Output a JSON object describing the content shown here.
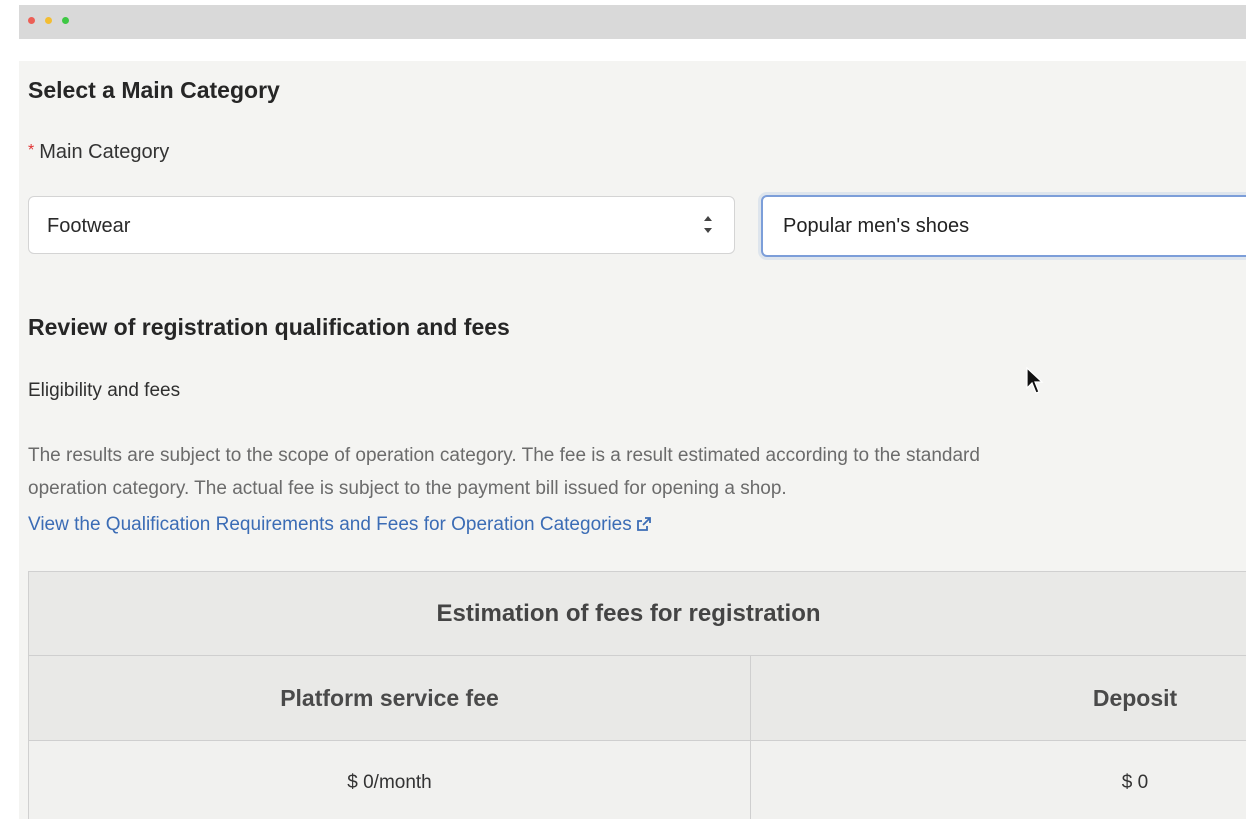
{
  "window": {
    "controls": [
      "close",
      "minimize",
      "maximize"
    ],
    "colors": {
      "close": "#ec5f56",
      "minimize": "#f3bd32",
      "maximize": "#3ec844"
    }
  },
  "form": {
    "section_title": "Select a Main Category",
    "main_category_label": "Main Category",
    "required_mark": "*",
    "main_category_value": "Footwear",
    "subcategory_value": "Popular men's shoes"
  },
  "review": {
    "title": "Review of registration qualification and fees",
    "subtitle": "Eligibility and fees",
    "description_line1": "The results are subject to the scope of operation category. The fee is a result estimated according to the standard",
    "description_line2": "operation category. The actual fee is subject to the payment bill issued for opening a shop.",
    "link_text": "View the Qualification Requirements and Fees for Operation Categories",
    "link_color": "#3b6cb5"
  },
  "fee_table": {
    "title": "Estimation of fees for registration",
    "columns": [
      "Platform service fee",
      "Deposit"
    ],
    "rows": [
      [
        "$ 0/month",
        "$ 0"
      ]
    ]
  },
  "icons": {
    "select_arrows": "up-down-chevron-icon",
    "external_link": "external-link-icon",
    "cursor": "mouse-pointer-icon"
  }
}
